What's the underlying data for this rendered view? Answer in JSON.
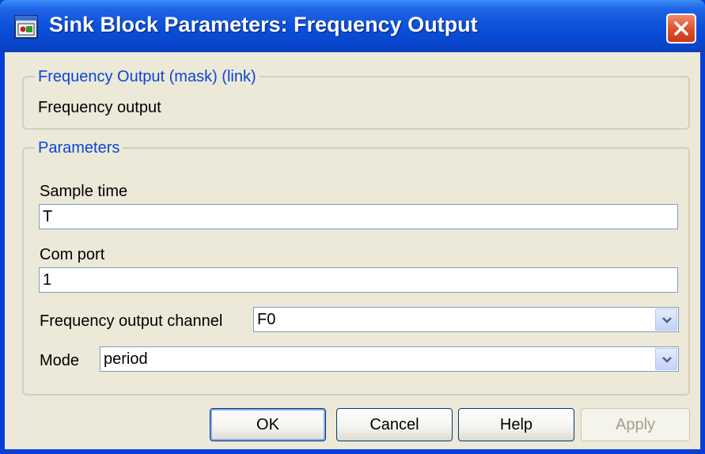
{
  "window": {
    "title": "Sink Block Parameters: Frequency Output"
  },
  "description_group": {
    "legend": "Frequency Output (mask) (link)",
    "text": "Frequency output"
  },
  "parameters_group": {
    "legend": "Parameters",
    "sample_time": {
      "label": "Sample time",
      "value": "T"
    },
    "com_port": {
      "label": "Com port",
      "value": "1"
    },
    "frequency_output_channel": {
      "label": "Frequency output channel",
      "value": "F0"
    },
    "mode": {
      "label": "Mode",
      "value": "period"
    }
  },
  "buttons": {
    "ok": "OK",
    "cancel": "Cancel",
    "help": "Help",
    "apply": "Apply"
  },
  "colors": {
    "titlebar": "#0a4fd8",
    "legend_text": "#0a46d4",
    "dialog_bg": "#ece9d8",
    "close_button": "#e0532e"
  },
  "icons": {
    "app": "simulink-block-icon",
    "close": "close-icon",
    "dropdown": "chevron-down-icon"
  }
}
